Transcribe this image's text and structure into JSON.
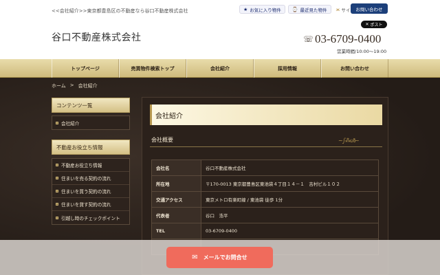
{
  "header": {
    "breadcrumb_top": "<<会社紹介>>東京都豊島区の不動産なら谷口不動産株式会社",
    "favorites_label": "お気に入り物件",
    "recent_label": "最近見た物件",
    "sitemap_label": "サイトマップ",
    "contact_label": "お問い合わせ",
    "x_post_label": "ポスト",
    "company_name": "谷口不動産株式会社",
    "phone": "03-6709-0400",
    "hours": "営業時間/10:00〜19:00"
  },
  "icons": {
    "star": "★",
    "clock": "⌚",
    "sitemap": "ж",
    "x": "✕",
    "phone": "☏",
    "mail": "✉"
  },
  "nav": {
    "items": [
      {
        "label": "トップページ"
      },
      {
        "label": "売買物件検索トップ"
      },
      {
        "label": "会社紹介"
      },
      {
        "label": "採用情報"
      },
      {
        "label": "お問い合わせ"
      }
    ]
  },
  "breadcrumb": {
    "home": "ホーム",
    "separator": ">",
    "current": "会社紹介"
  },
  "sidebar": {
    "contents_heading": "コンテンツ一覧",
    "contents_items": [
      {
        "label": "会社紹介"
      }
    ],
    "tips_heading": "不動産お役立ち情報",
    "tips_items": [
      {
        "label": "不動産お役立ち情報"
      },
      {
        "label": "住まいを売る契約の流れ"
      },
      {
        "label": "住まいを買う契約の流れ"
      },
      {
        "label": "住まいを貸す契約の流れ"
      },
      {
        "label": "引越し時のチェックポイント"
      }
    ]
  },
  "main": {
    "title": "会社紹介",
    "subtitle": "会社概要",
    "ornament": "~ഽ⁂ൾ~",
    "rows": [
      {
        "key": "会社名",
        "value": "谷口不動産株式会社"
      },
      {
        "key": "所在地",
        "value": "〒170-0013 東京都豊島区東池袋４丁目１４－１　吉村ビル１０２"
      },
      {
        "key": "交通アクセス",
        "value": "東京メトロ有楽町線 / 東池袋 徒歩 1分"
      },
      {
        "key": "代表者",
        "value": "谷口　浩平"
      },
      {
        "key": "TEL",
        "value": "03-6709-0400"
      },
      {
        "key": "",
        "value": ""
      }
    ]
  },
  "float": {
    "mail_label": "メールでお問合せ"
  }
}
